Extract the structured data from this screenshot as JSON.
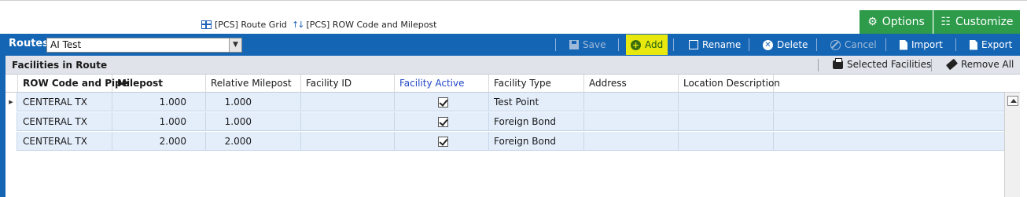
{
  "top_links": [
    {
      "label": "[PCS] Route Grid",
      "icon": "grid-icon"
    },
    {
      "label": "[PCS] ROW Code and Milepost",
      "icon": "sort-arrows-icon"
    }
  ],
  "top_buttons": {
    "options": "Options",
    "customize": "Customize"
  },
  "toolbar": {
    "routes_label": "Routes",
    "route_value": "AI Test",
    "save": "Save",
    "add": "Add",
    "rename": "Rename",
    "delete": "Delete",
    "cancel": "Cancel",
    "import": "Import",
    "export": "Export"
  },
  "facilities": {
    "title": "Facilities in Route",
    "selected_facilities": "Selected Facilities",
    "remove_all": "Remove All"
  },
  "grid": {
    "columns": [
      "ROW Code and Pipe",
      "Milepost",
      "Relative Milepost",
      "Facility ID",
      "Facility Active",
      "Facility Type",
      "Address",
      "Location Description"
    ],
    "rows": [
      {
        "row_code": "CENTERAL TX",
        "milepost": "1.000",
        "relative": "1.000",
        "facility_id": "",
        "active": true,
        "type": "Test Point",
        "address": "",
        "location": ""
      },
      {
        "row_code": "CENTERAL TX",
        "milepost": "1.000",
        "relative": "1.000",
        "facility_id": "",
        "active": true,
        "type": "Foreign Bond",
        "address": "",
        "location": ""
      },
      {
        "row_code": "CENTERAL TX",
        "milepost": "2.000",
        "relative": "2.000",
        "facility_id": "",
        "active": true,
        "type": "Foreign Bond",
        "address": "",
        "location": ""
      }
    ]
  },
  "colors": {
    "toolbar_blue": "#1565b5",
    "green_button": "#2d9b4a",
    "add_highlight": "#e8e80f",
    "row_bg": "#e4eefb"
  }
}
